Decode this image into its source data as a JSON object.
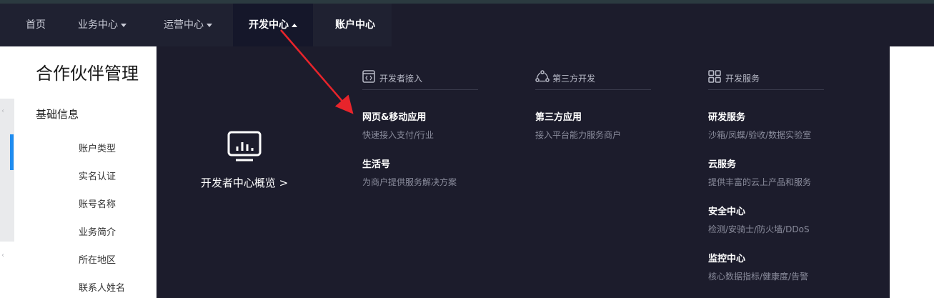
{
  "nav": {
    "items": [
      {
        "label": "首页"
      },
      {
        "label": "业务中心"
      },
      {
        "label": "运营中心"
      },
      {
        "label": "开发中心"
      },
      {
        "label": "账户中心"
      }
    ]
  },
  "sidebar": {
    "title": "合作伙伴管理",
    "section": "基础信息",
    "items": [
      "账户类型",
      "实名认证",
      "账号名称",
      "业务简介",
      "所在地区",
      "联系人姓名"
    ]
  },
  "menu": {
    "overview_label": "开发者中心概览 >",
    "columns": [
      {
        "header": "开发者接入",
        "entries": [
          {
            "title": "网页&移动应用",
            "desc": "快速接入支付/行业"
          },
          {
            "title": "生活号",
            "desc": "为商户提供服务解决方案"
          }
        ]
      },
      {
        "header": "第三方开发",
        "entries": [
          {
            "title": "第三方应用",
            "desc": "接入平台能力服务商户"
          }
        ]
      },
      {
        "header": "开发服务",
        "entries": [
          {
            "title": "研发服务",
            "desc": "沙箱/凤蝶/验收/数据实验室"
          },
          {
            "title": "云服务",
            "desc": "提供丰富的云上产品和服务"
          },
          {
            "title": "安全中心",
            "desc": "检测/安骑士/防火墙/DDoS"
          },
          {
            "title": "监控中心",
            "desc": "核心数据指标/健康度/告警"
          }
        ]
      }
    ]
  },
  "icons": {
    "overview": "chart-board-icon",
    "developer_access": "code-window-icon",
    "third_party": "share-nodes-icon",
    "dev_services": "grid-icon",
    "annotation": "red-arrow"
  },
  "colors": {
    "navbar_bg": "#1f2131",
    "menu_bg": "#1c1c2c",
    "accent_blue": "#1e8cf0",
    "annotation_red": "#e8242b"
  }
}
